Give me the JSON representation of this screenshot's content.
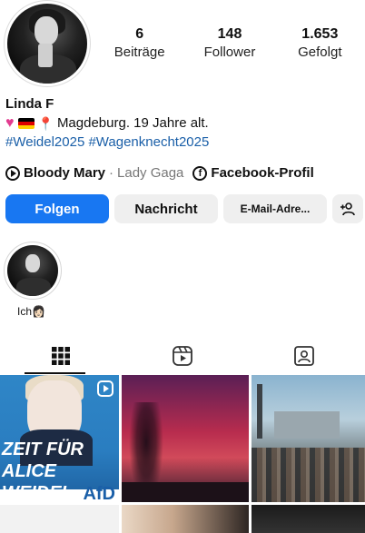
{
  "profile": {
    "name": "Linda F",
    "stats": [
      {
        "value": "6",
        "label": "Beiträge"
      },
      {
        "value": "148",
        "label": "Follower"
      },
      {
        "value": "1.653",
        "label": "Gefolgt"
      }
    ],
    "bio_text": "Magdeburg. 19 Jahre alt.",
    "hashtags": "#Weidel2025 #Wagenknecht2025",
    "song_title": "Bloody Mary",
    "song_separator": "·",
    "song_artist": "Lady Gaga",
    "facebook_label": "Facebook-Profil"
  },
  "actions": {
    "follow": "Folgen",
    "message": "Nachricht",
    "email": "E-Mail-Adre..."
  },
  "highlights": [
    {
      "label": "Ich👩🏻"
    }
  ],
  "posts": {
    "first_post_text": "ZEIT FÜR ALICE WEIDEL",
    "first_post_logo": "AfD"
  },
  "colors": {
    "accent": "#1877f2",
    "hashtag": "#1a5fa8"
  },
  "icons": [
    "heart-icon",
    "germany-flag-icon",
    "location-pin-icon",
    "music-play-icon",
    "facebook-icon",
    "add-person-icon",
    "grid-icon",
    "reels-icon",
    "tagged-icon"
  ]
}
